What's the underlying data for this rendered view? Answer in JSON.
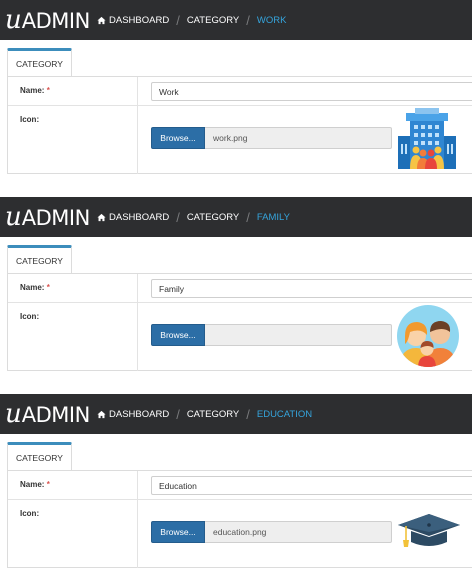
{
  "panels": [
    {
      "logo": {
        "u": "u",
        "admin": "ADMIN"
      },
      "breadcrumb": {
        "dashboard": "DASHBOARD",
        "category": "CATEGORY",
        "current": "WORK"
      },
      "tab_label": "CATEGORY",
      "name_label": "Name:",
      "required_mark": "*",
      "name_value": "Work",
      "icon_label": "Icon:",
      "browse_label": "Browse...",
      "file_name": "work.png",
      "icon": "work-building-icon"
    },
    {
      "logo": {
        "u": "u",
        "admin": "ADMIN"
      },
      "breadcrumb": {
        "dashboard": "DASHBOARD",
        "category": "CATEGORY",
        "current": "FAMILY"
      },
      "tab_label": "CATEGORY",
      "name_label": "Name:",
      "required_mark": "*",
      "name_value": "Family",
      "icon_label": "Icon:",
      "browse_label": "Browse...",
      "file_name": "",
      "icon": "family-icon"
    },
    {
      "logo": {
        "u": "u",
        "admin": "ADMIN"
      },
      "breadcrumb": {
        "dashboard": "DASHBOARD",
        "category": "CATEGORY",
        "current": "EDUCATION"
      },
      "tab_label": "CATEGORY",
      "name_label": "Name:",
      "required_mark": "*",
      "name_value": "Education",
      "icon_label": "Icon:",
      "browse_label": "Browse...",
      "file_name": "education.png",
      "icon": "graduation-cap-icon"
    }
  ],
  "colors": {
    "topbar": "#2d2e30",
    "active_crumb": "#35a4dc",
    "browse": "#2c6ea6",
    "required": "#d9534f"
  }
}
